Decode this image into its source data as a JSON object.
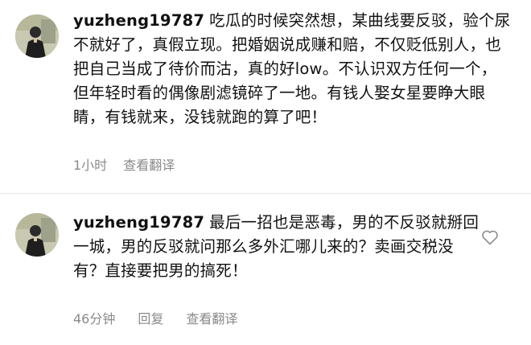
{
  "comments": [
    {
      "username": "yuzheng19787",
      "text": "吃瓜的时候突然想，某曲线要反驳，验个尿不就好了，真假立现。把婚姻说成赚和赔，不仅贬低别人，也把自己当成了待价而沽，真的好low。不认识双方任何一个，但年轻时看的偶像剧滤镜碎了一地。有钱人娶女星要睁大眼睛，有钱就来，没钱就跑的算了吧！",
      "time": "1小时",
      "translate": "查看翻译"
    },
    {
      "username": "yuzheng19787",
      "text": "最后一招也是恶毒，男的不反驳就掰回一城，男的反驳就问那么多外汇哪儿来的？卖画交税没有？直接要把男的搞死！",
      "time": "46分钟",
      "reply": "回复",
      "translate": "查看翻译",
      "like_icon": "heart-outline-icon"
    }
  ]
}
